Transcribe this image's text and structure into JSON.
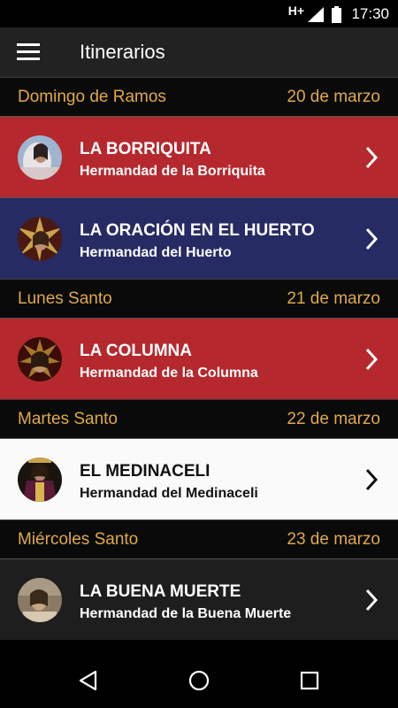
{
  "status_bar": {
    "network": "H+",
    "time": "17:30"
  },
  "app_bar": {
    "title": "Itinerarios"
  },
  "sections": [
    {
      "day": "Domingo de Ramos",
      "date": "20 de marzo",
      "items": [
        {
          "name": "LA BORRIQUITA",
          "brotherhood": "Hermandad de la Borriquita",
          "color": "#b5282e"
        },
        {
          "name": "LA ORACIÓN EN EL HUERTO",
          "brotherhood": "Hermandad del Huerto",
          "color": "#272b63"
        }
      ]
    },
    {
      "day": "Lunes Santo",
      "date": "21 de marzo",
      "items": [
        {
          "name": "LA COLUMNA",
          "brotherhood": "Hermandad de la Columna",
          "color": "#b5282e"
        }
      ]
    },
    {
      "day": "Martes Santo",
      "date": "22 de marzo",
      "items": [
        {
          "name": "EL MEDINACELI",
          "brotherhood": "Hermandad del Medinaceli",
          "color": "#fafafa"
        }
      ]
    },
    {
      "day": "Miércoles Santo",
      "date": "23 de marzo",
      "items": [
        {
          "name": "LA BUENA MUERTE",
          "brotherhood": "Hermandad de la Buena Muerte",
          "color": "#1e1e1e"
        }
      ]
    }
  ],
  "theme": {
    "accent": "#e0a94a"
  }
}
